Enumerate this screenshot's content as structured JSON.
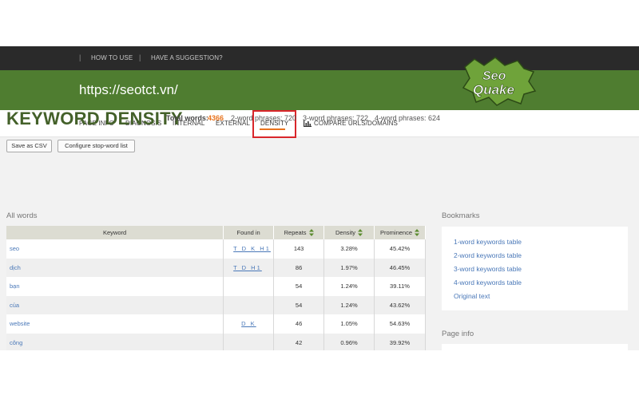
{
  "topbar": {
    "links": [
      "HOW TO USE",
      "HAVE A SUGGESTION?"
    ]
  },
  "banner": {
    "url": "https://seotct.vn/",
    "logo_top": "Seo",
    "logo_bottom": "Quake"
  },
  "nav": {
    "tabs": [
      "PAGE INFO",
      "DIAGNOSIS",
      "INTERNAL",
      "EXTERNAL",
      "DENSITY",
      "COMPARE URLS/DOMAINS"
    ],
    "active": "DENSITY"
  },
  "page": {
    "title": "KEYWORD DENSITY",
    "total_words_label": "Total words:",
    "total_words_value": "4366",
    "phrases2": "2-word phrases: 720",
    "phrases3": "3-word phrases: 722",
    "phrases4": "4-word phrases: 624",
    "save_csv": "Save as CSV",
    "configure": "Configure stop-word list",
    "all_words": "All words"
  },
  "table": {
    "headers": [
      "Keyword",
      "Found in",
      "Repeats",
      "Density",
      "Prominence"
    ],
    "rows": [
      {
        "keyword": "seo",
        "found": "T D K H1",
        "repeats": "143",
        "density": "3.28%",
        "prominence": "45.42%"
      },
      {
        "keyword": "dịch",
        "found": "T D H1",
        "repeats": "86",
        "density": "1.97%",
        "prominence": "46.45%"
      },
      {
        "keyword": "bạn",
        "found": "",
        "repeats": "54",
        "density": "1.24%",
        "prominence": "39.11%"
      },
      {
        "keyword": "của",
        "found": "",
        "repeats": "54",
        "density": "1.24%",
        "prominence": "43.62%"
      },
      {
        "keyword": "website",
        "found": "D K",
        "repeats": "46",
        "density": "1.05%",
        "prominence": "54.63%"
      },
      {
        "keyword": "công",
        "found": "",
        "repeats": "42",
        "density": "0.96%",
        "prominence": "39.92%"
      }
    ]
  },
  "sidebar": {
    "bookmarks_label": "Bookmarks",
    "bookmarks": [
      "1-word keywords table",
      "2-word keywords table",
      "3-word keywords table",
      "4-word keywords table",
      "Original text"
    ],
    "pageinfo_label": "Page info"
  },
  "colors": {
    "brand_green": "#4f7d30",
    "title_green": "#44612a",
    "accent_orange": "#e8731d",
    "highlight_red": "#d9262b",
    "link_blue": "#4a78b8"
  }
}
